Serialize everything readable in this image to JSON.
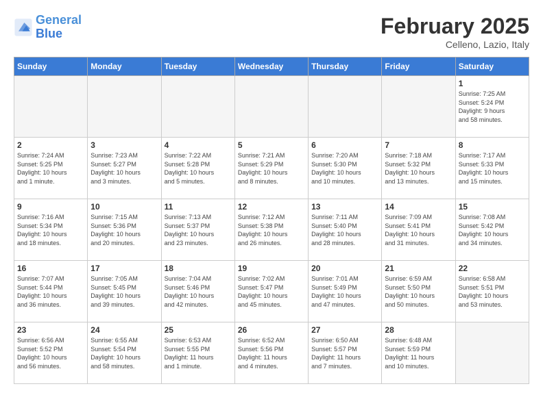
{
  "header": {
    "logo_line1": "General",
    "logo_line2": "Blue",
    "month_title": "February 2025",
    "location": "Celleno, Lazio, Italy"
  },
  "weekdays": [
    "Sunday",
    "Monday",
    "Tuesday",
    "Wednesday",
    "Thursday",
    "Friday",
    "Saturday"
  ],
  "weeks": [
    [
      {
        "day": "",
        "info": ""
      },
      {
        "day": "",
        "info": ""
      },
      {
        "day": "",
        "info": ""
      },
      {
        "day": "",
        "info": ""
      },
      {
        "day": "",
        "info": ""
      },
      {
        "day": "",
        "info": ""
      },
      {
        "day": "1",
        "info": "Sunrise: 7:25 AM\nSunset: 5:24 PM\nDaylight: 9 hours\nand 58 minutes."
      }
    ],
    [
      {
        "day": "2",
        "info": "Sunrise: 7:24 AM\nSunset: 5:25 PM\nDaylight: 10 hours\nand 1 minute."
      },
      {
        "day": "3",
        "info": "Sunrise: 7:23 AM\nSunset: 5:27 PM\nDaylight: 10 hours\nand 3 minutes."
      },
      {
        "day": "4",
        "info": "Sunrise: 7:22 AM\nSunset: 5:28 PM\nDaylight: 10 hours\nand 5 minutes."
      },
      {
        "day": "5",
        "info": "Sunrise: 7:21 AM\nSunset: 5:29 PM\nDaylight: 10 hours\nand 8 minutes."
      },
      {
        "day": "6",
        "info": "Sunrise: 7:20 AM\nSunset: 5:30 PM\nDaylight: 10 hours\nand 10 minutes."
      },
      {
        "day": "7",
        "info": "Sunrise: 7:18 AM\nSunset: 5:32 PM\nDaylight: 10 hours\nand 13 minutes."
      },
      {
        "day": "8",
        "info": "Sunrise: 7:17 AM\nSunset: 5:33 PM\nDaylight: 10 hours\nand 15 minutes."
      }
    ],
    [
      {
        "day": "9",
        "info": "Sunrise: 7:16 AM\nSunset: 5:34 PM\nDaylight: 10 hours\nand 18 minutes."
      },
      {
        "day": "10",
        "info": "Sunrise: 7:15 AM\nSunset: 5:36 PM\nDaylight: 10 hours\nand 20 minutes."
      },
      {
        "day": "11",
        "info": "Sunrise: 7:13 AM\nSunset: 5:37 PM\nDaylight: 10 hours\nand 23 minutes."
      },
      {
        "day": "12",
        "info": "Sunrise: 7:12 AM\nSunset: 5:38 PM\nDaylight: 10 hours\nand 26 minutes."
      },
      {
        "day": "13",
        "info": "Sunrise: 7:11 AM\nSunset: 5:40 PM\nDaylight: 10 hours\nand 28 minutes."
      },
      {
        "day": "14",
        "info": "Sunrise: 7:09 AM\nSunset: 5:41 PM\nDaylight: 10 hours\nand 31 minutes."
      },
      {
        "day": "15",
        "info": "Sunrise: 7:08 AM\nSunset: 5:42 PM\nDaylight: 10 hours\nand 34 minutes."
      }
    ],
    [
      {
        "day": "16",
        "info": "Sunrise: 7:07 AM\nSunset: 5:44 PM\nDaylight: 10 hours\nand 36 minutes."
      },
      {
        "day": "17",
        "info": "Sunrise: 7:05 AM\nSunset: 5:45 PM\nDaylight: 10 hours\nand 39 minutes."
      },
      {
        "day": "18",
        "info": "Sunrise: 7:04 AM\nSunset: 5:46 PM\nDaylight: 10 hours\nand 42 minutes."
      },
      {
        "day": "19",
        "info": "Sunrise: 7:02 AM\nSunset: 5:47 PM\nDaylight: 10 hours\nand 45 minutes."
      },
      {
        "day": "20",
        "info": "Sunrise: 7:01 AM\nSunset: 5:49 PM\nDaylight: 10 hours\nand 47 minutes."
      },
      {
        "day": "21",
        "info": "Sunrise: 6:59 AM\nSunset: 5:50 PM\nDaylight: 10 hours\nand 50 minutes."
      },
      {
        "day": "22",
        "info": "Sunrise: 6:58 AM\nSunset: 5:51 PM\nDaylight: 10 hours\nand 53 minutes."
      }
    ],
    [
      {
        "day": "23",
        "info": "Sunrise: 6:56 AM\nSunset: 5:52 PM\nDaylight: 10 hours\nand 56 minutes."
      },
      {
        "day": "24",
        "info": "Sunrise: 6:55 AM\nSunset: 5:54 PM\nDaylight: 10 hours\nand 58 minutes."
      },
      {
        "day": "25",
        "info": "Sunrise: 6:53 AM\nSunset: 5:55 PM\nDaylight: 11 hours\nand 1 minute."
      },
      {
        "day": "26",
        "info": "Sunrise: 6:52 AM\nSunset: 5:56 PM\nDaylight: 11 hours\nand 4 minutes."
      },
      {
        "day": "27",
        "info": "Sunrise: 6:50 AM\nSunset: 5:57 PM\nDaylight: 11 hours\nand 7 minutes."
      },
      {
        "day": "28",
        "info": "Sunrise: 6:48 AM\nSunset: 5:59 PM\nDaylight: 11 hours\nand 10 minutes."
      },
      {
        "day": "",
        "info": ""
      }
    ]
  ]
}
